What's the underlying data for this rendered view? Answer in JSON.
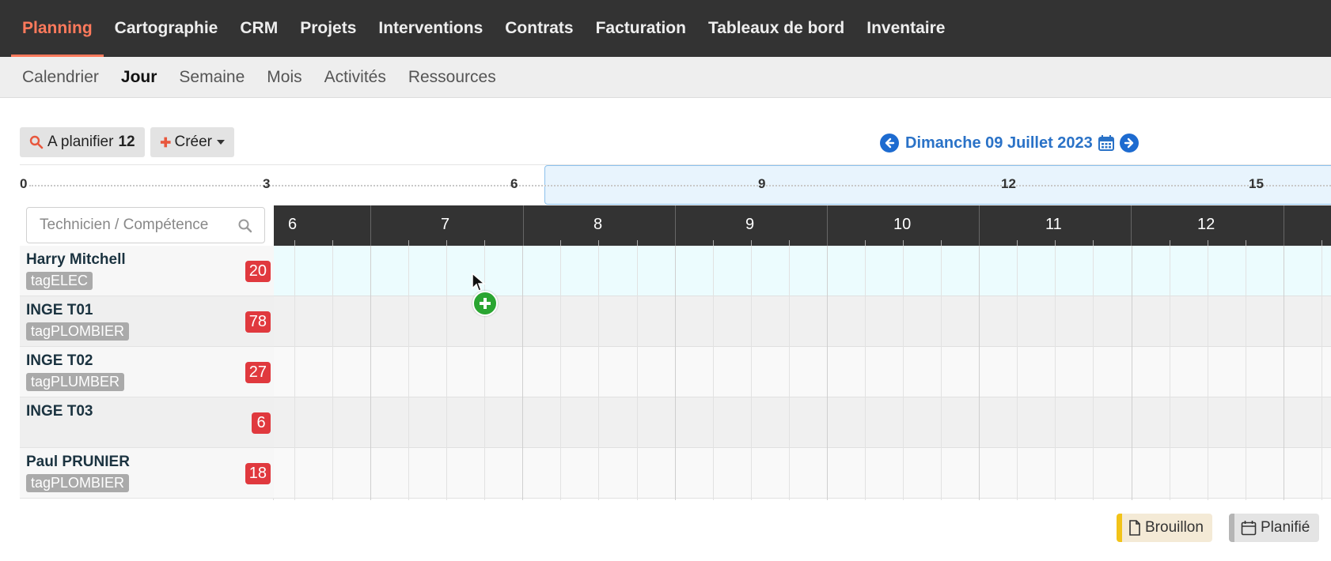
{
  "topnav": {
    "items": [
      {
        "label": "Planning",
        "active": true
      },
      {
        "label": "Cartographie"
      },
      {
        "label": "CRM"
      },
      {
        "label": "Projets"
      },
      {
        "label": "Interventions"
      },
      {
        "label": "Contrats"
      },
      {
        "label": "Facturation"
      },
      {
        "label": "Tableaux de bord"
      },
      {
        "label": "Inventaire"
      }
    ]
  },
  "subnav": {
    "items": [
      {
        "label": "Calendrier"
      },
      {
        "label": "Jour",
        "active": true
      },
      {
        "label": "Semaine"
      },
      {
        "label": "Mois"
      },
      {
        "label": "Activités"
      },
      {
        "label": "Ressources"
      }
    ]
  },
  "toolbar": {
    "planifier_label": "A planifier",
    "planifier_count": "12",
    "creer_label": "Créer"
  },
  "date_nav": {
    "date": "Dimanche 09 Juillet 2023"
  },
  "overview": {
    "labels": [
      "0",
      "3",
      "6",
      "9",
      "12",
      "15"
    ]
  },
  "search": {
    "placeholder": "Technicien / Compétence"
  },
  "hours": [
    "6",
    "7",
    "8",
    "9",
    "10",
    "11",
    "12"
  ],
  "technicians": [
    {
      "name": "Harry Mitchell",
      "tag": "tagELEC",
      "count": "20"
    },
    {
      "name": "INGE T01",
      "tag": "tagPLOMBIER",
      "count": "78"
    },
    {
      "name": "INGE T02",
      "tag": "tagPLUMBER",
      "count": "27"
    },
    {
      "name": "INGE T03",
      "tag": "",
      "count": "6"
    },
    {
      "name": "Paul PRUNIER",
      "tag": "tagPLOMBIER",
      "count": "18"
    }
  ],
  "legend": {
    "draft_label": "Brouillon",
    "planned_label": "Planifié"
  },
  "colors": {
    "accent": "#ff7a5c",
    "nav_bg": "#333333",
    "link_blue": "#2a72c7",
    "badge_red": "#e0393e",
    "add_green": "#2aa531",
    "draft_yellow": "#f2c318"
  },
  "icons": {
    "search": "search-icon",
    "plus": "plus-icon",
    "prev": "arrow-left-circle-icon",
    "next": "arrow-right-circle-icon",
    "calendar": "calendar-icon",
    "add": "add-circle-icon",
    "file": "file-icon"
  }
}
